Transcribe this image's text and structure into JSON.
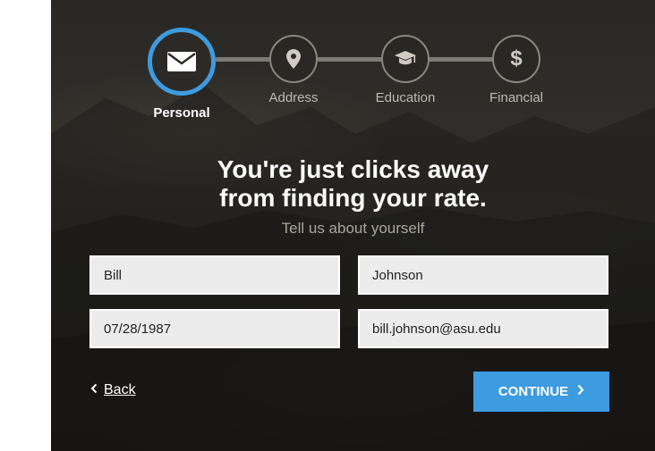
{
  "steps": [
    {
      "label": "Personal",
      "icon": "envelope-icon",
      "active": true
    },
    {
      "label": "Address",
      "icon": "map-pin-icon",
      "active": false
    },
    {
      "label": "Education",
      "icon": "graduation-cap-icon",
      "active": false
    },
    {
      "label": "Financial",
      "icon": "dollar-icon",
      "active": false
    }
  ],
  "headline": {
    "line1": "You're just clicks away",
    "line2": "from finding your rate."
  },
  "subheading": "Tell us about yourself",
  "form": {
    "first_name": "Bill",
    "last_name": "Johnson",
    "dob": "07/28/1987",
    "email": "bill.johnson@asu.edu"
  },
  "nav": {
    "back_label": "Back",
    "continue_label": "CONTINUE"
  },
  "colors": {
    "accent": "#3d9be0",
    "field_bg": "#ececec",
    "panel_bg": "#2b2926"
  }
}
